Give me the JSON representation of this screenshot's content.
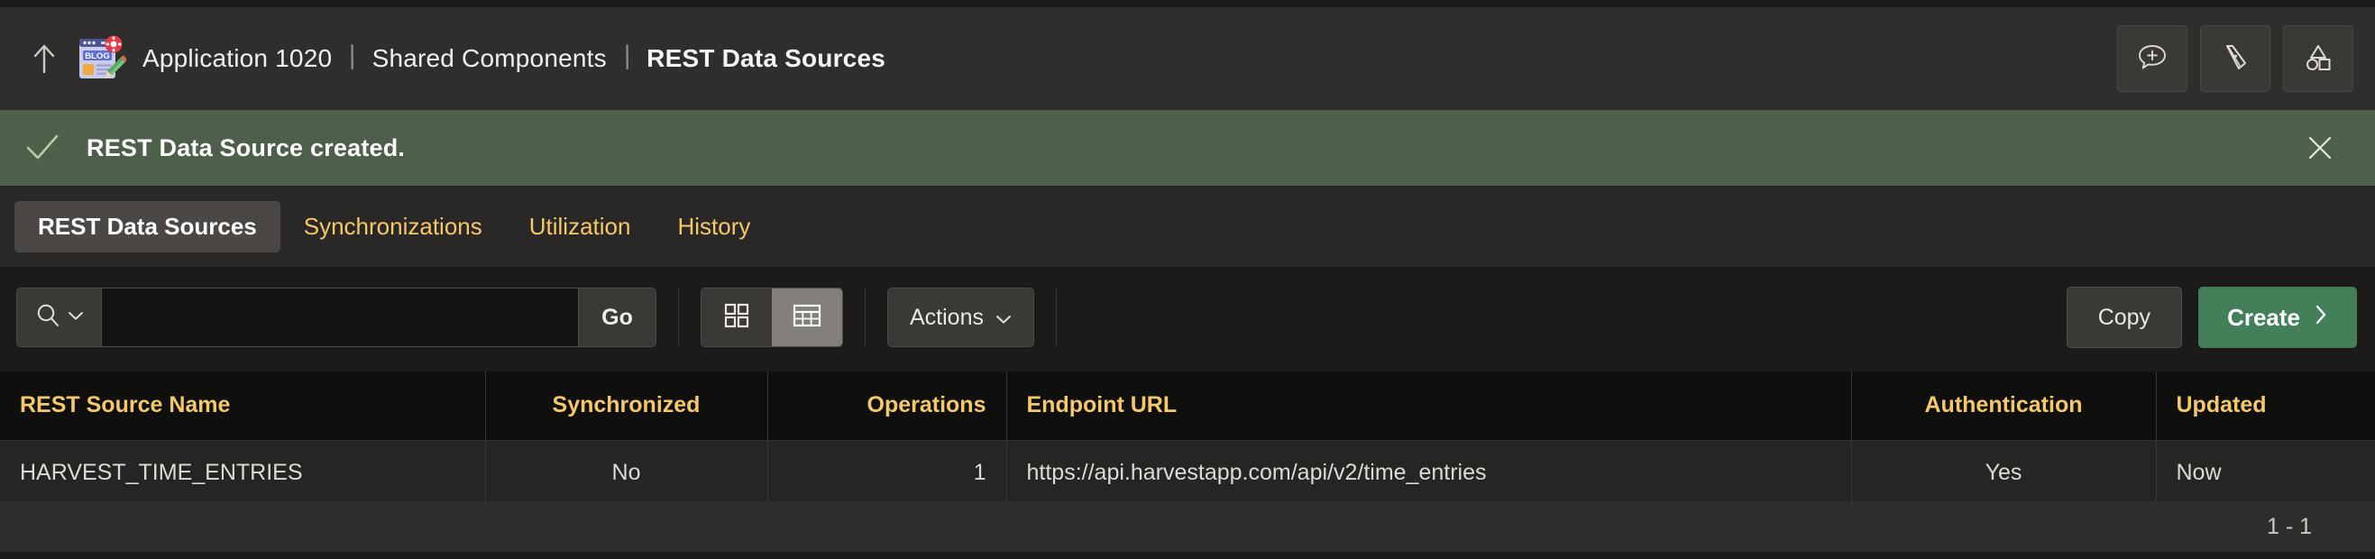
{
  "topbar": {
    "back_icon": "up-arrow-icon",
    "app_icon": "blog-app-icon",
    "app_icon_label": "BLOG",
    "breadcrumbs": [
      {
        "label": "Application 1020",
        "current": false
      },
      {
        "label": "Shared Components",
        "current": false
      },
      {
        "label": "REST Data Sources",
        "current": true
      }
    ],
    "separator": "\\",
    "actions": [
      {
        "name": "add-comment-icon",
        "title": "Comments"
      },
      {
        "name": "theme-roller-icon",
        "title": "Theme Roller"
      },
      {
        "name": "quick-edit-shapes-icon",
        "title": "Quick Edit"
      }
    ]
  },
  "notification": {
    "icon": "check-icon",
    "message": "REST Data Source created.",
    "close_icon": "close-icon",
    "background": "#4d6049"
  },
  "tabs": [
    {
      "label": "REST Data Sources",
      "active": true
    },
    {
      "label": "Synchronizations",
      "active": false
    },
    {
      "label": "Utilization",
      "active": false
    },
    {
      "label": "History",
      "active": false
    }
  ],
  "toolbar": {
    "search": {
      "icon": "search-icon",
      "dropdown_icon": "chevron-down-icon",
      "value": "",
      "placeholder": ""
    },
    "go_label": "Go",
    "view_toggle": [
      {
        "name": "cards-view-icon",
        "active": false
      },
      {
        "name": "grid-view-icon",
        "active": true
      }
    ],
    "actions_label": "Actions",
    "actions_icon": "chevron-down-icon",
    "copy_label": "Copy",
    "create_label": "Create",
    "create_icon": "chevron-right-icon"
  },
  "table": {
    "columns": [
      {
        "label": "REST Source Name",
        "align": "al-left"
      },
      {
        "label": "Synchronized",
        "align": "al-center"
      },
      {
        "label": "Operations",
        "align": "al-right"
      },
      {
        "label": "Endpoint URL",
        "align": "al-left"
      },
      {
        "label": "Authentication",
        "align": "al-center"
      },
      {
        "label": "Updated",
        "align": "al-left"
      }
    ],
    "rows": [
      {
        "rest_source_name": "HARVEST_TIME_ENTRIES",
        "synchronized": "No",
        "operations": "1",
        "endpoint_url": "https://api.harvestapp.com/api/v2/time_entries",
        "authentication": "Yes",
        "updated": "Now"
      }
    ]
  },
  "pagination": {
    "range": "1 - 1"
  },
  "colors": {
    "accent_amber": "#f5c86a",
    "success_green": "#4d6049",
    "create_green": "#43805a",
    "page_bg": "#1c1b1a",
    "bar_bg": "#302e2c"
  }
}
